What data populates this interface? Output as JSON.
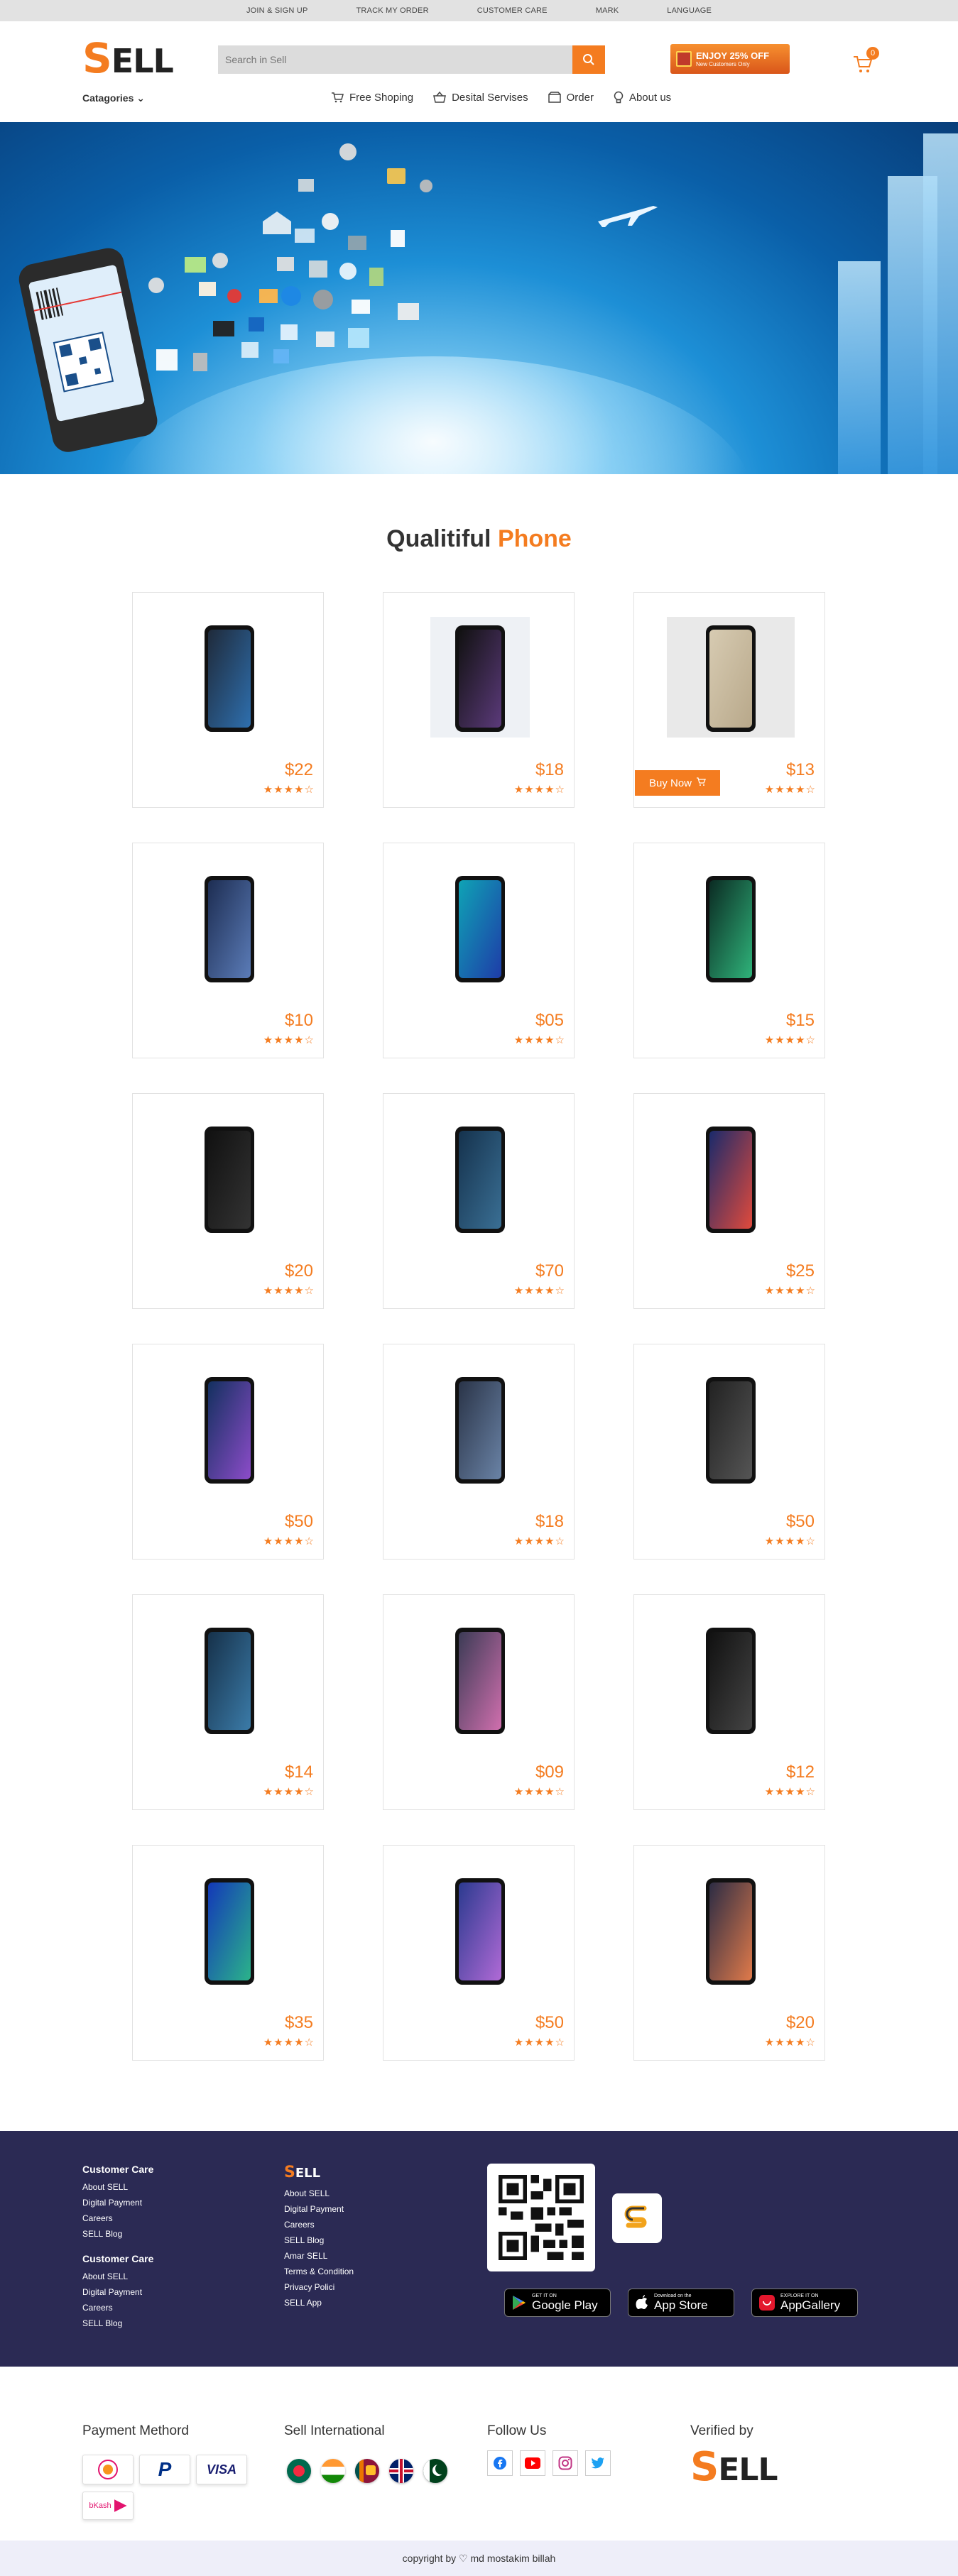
{
  "topbar": {
    "links": [
      "JOIN & SIGN UP",
      "TRACK MY ORDER",
      "CUSTOMER CARE",
      "MARK",
      "LANGUAGE"
    ]
  },
  "header": {
    "logo_first": "S",
    "logo_rest": "ELL",
    "search_placeholder": "Search in Sell",
    "promo_title": "ENJOY 25% OFF",
    "promo_sub": "New Customers Only",
    "cart_count": "0",
    "categories_label": "Catagories",
    "nav": [
      "Free Shoping",
      "Desital Servises",
      "Order",
      "About us"
    ]
  },
  "section": {
    "title_main": "Qualitiful",
    "title_accent": "Phone"
  },
  "products": [
    {
      "price": "$22",
      "stars": "★★★★☆"
    },
    {
      "price": "$18",
      "stars": "★★★★☆"
    },
    {
      "price": "$13",
      "stars": "★★★★☆",
      "buy": "Buy Now"
    },
    {
      "price": "$10",
      "stars": "★★★★☆"
    },
    {
      "price": "$05",
      "stars": "★★★★☆"
    },
    {
      "price": "$15",
      "stars": "★★★★☆"
    },
    {
      "price": "$20",
      "stars": "★★★★☆"
    },
    {
      "price": "$70",
      "stars": "★★★★☆"
    },
    {
      "price": "$25",
      "stars": "★★★★☆"
    },
    {
      "price": "$50",
      "stars": "★★★★☆"
    },
    {
      "price": "$18",
      "stars": "★★★★☆"
    },
    {
      "price": "$50",
      "stars": "★★★★☆"
    },
    {
      "price": "$14",
      "stars": "★★★★☆"
    },
    {
      "price": "$09",
      "stars": "★★★★☆"
    },
    {
      "price": "$12",
      "stars": "★★★★☆"
    },
    {
      "price": "$35",
      "stars": "★★★★☆"
    },
    {
      "price": "$50",
      "stars": "★★★★☆"
    },
    {
      "price": "$20",
      "stars": "★★★★☆"
    }
  ],
  "footer": {
    "col1_title_a": "Customer Care",
    "col1_links_a": [
      "About SELL",
      "Digital Payment",
      "Careers",
      "SELL Blog"
    ],
    "col1_title_b": "Customer Care",
    "col1_links_b": [
      "About SELL",
      "Digital Payment",
      "Careers",
      "SELL Blog"
    ],
    "col2_logo_first": "S",
    "col2_logo_rest": "ELL",
    "col2_links": [
      "About SELL",
      "Digital Payment",
      "Careers",
      "SELL Blog",
      "Amar SELL",
      "Terms & Condition",
      "Privacy Polici",
      "SELL App"
    ],
    "stores": [
      {
        "small": "GET IT ON",
        "big": "Google Play"
      },
      {
        "small": "Download on the",
        "big": "App Store"
      },
      {
        "small": "EXPLORE IT ON",
        "big": "AppGallery"
      }
    ]
  },
  "bottom": {
    "payment_title": "Payment Methord",
    "payment_methods": [
      "bKash",
      "PayPal",
      "VISA"
    ],
    "intl_title": "Sell International",
    "follow_title": "Follow Us",
    "verified_title": "Verified by",
    "verified_logo_first": "S",
    "verified_logo_rest": "ELL"
  },
  "copyright": {
    "prefix": "copyright by",
    "author": "md mostakim billah"
  },
  "colors": {
    "accent": "#f47c20",
    "footer_bg": "#2b2a54"
  }
}
